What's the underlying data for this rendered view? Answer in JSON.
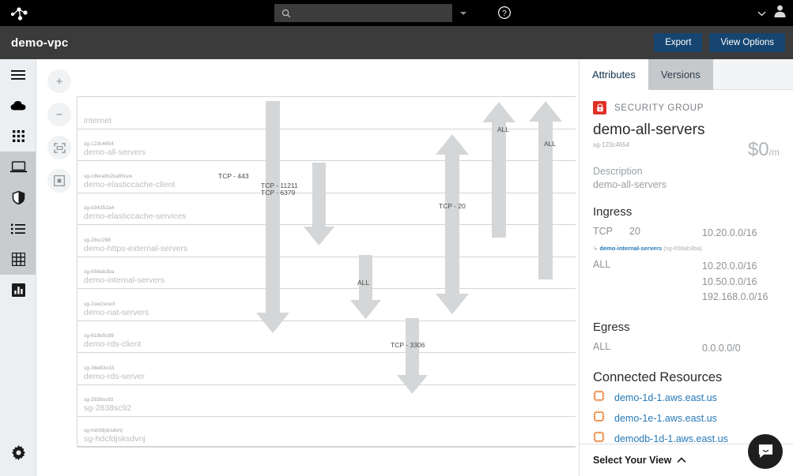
{
  "topbar": {
    "logo_icon": "network-nodes-logo",
    "search_placeholder": "",
    "search_value": "",
    "search_icon": "search-icon",
    "search_caret_icon": "caret-down-icon",
    "help_icon": "help-circle-icon",
    "account_caret_icon": "chevron-down-icon",
    "account_icon": "user-avatar-icon"
  },
  "subbar": {
    "title": "demo-vpc",
    "export_label": "Export",
    "view_options_label": "View Options"
  },
  "rail": {
    "items": [
      {
        "name": "menu-icon",
        "glyph": "hamburger"
      },
      {
        "name": "cloud-icon",
        "glyph": "cloud"
      },
      {
        "name": "apps-grid-icon",
        "glyph": "dots-grid"
      },
      {
        "name": "laptop-icon",
        "glyph": "laptop"
      },
      {
        "name": "shield-icon",
        "glyph": "shield"
      },
      {
        "name": "list-icon",
        "glyph": "list"
      },
      {
        "name": "table-icon",
        "glyph": "table"
      },
      {
        "name": "chart-icon",
        "glyph": "chart"
      }
    ],
    "settings_icon": "gear-icon"
  },
  "canvas": {
    "zoom_in_label": "+",
    "zoom_out_label": "−",
    "fit_icon": "fit-to-screen-icon",
    "center_icon": "center-target-icon",
    "rows": [
      {
        "id": "",
        "name": "internet",
        "is_internet": true
      },
      {
        "id": "sg-123c4654",
        "name": "demo-all-servers"
      },
      {
        "id": "sg-c8wıa9s2ka9fiıuw",
        "name": "demo-elasticcache-client"
      },
      {
        "id": "sg-d34352a4",
        "name": "demo-elasticcache-services"
      },
      {
        "id": "sg-28sc298",
        "name": "demo-https-external-servers"
      },
      {
        "id": "sg-658ab3ba",
        "name": "demo-internal-servers"
      },
      {
        "id": "sg-1sw2scw3",
        "name": "demo-nat-servers"
      },
      {
        "id": "sg-618e5c99",
        "name": "demo-rds-client"
      },
      {
        "id": "sg-38e83o33",
        "name": "demo-rds-server"
      },
      {
        "id": "sg-2838sc92",
        "name": "sg-2838sc92"
      },
      {
        "id": "sg-hdcfdjsksdvnj",
        "name": "sg-hdcfdjsksdvnj"
      }
    ],
    "connections": [
      {
        "label": "TCP - 443",
        "direction": "down"
      },
      {
        "label": "TCP - 11211\nTCP - 6379",
        "direction": "down"
      },
      {
        "label": "ALL",
        "direction": "down"
      },
      {
        "label": "TCP - 3306",
        "direction": "down"
      },
      {
        "label": "TCP - 20",
        "direction": "both"
      },
      {
        "label": "ALL",
        "direction": "up"
      },
      {
        "label": "ALL",
        "direction": "up"
      }
    ]
  },
  "panel": {
    "tabs": [
      {
        "label": "Attributes",
        "active": true
      },
      {
        "label": "Versions",
        "active": false
      }
    ],
    "badge_label": "SECURITY GROUP",
    "lock_icon": "lock-icon",
    "resource_name": "demo-all-servers",
    "resource_id": "sg-123c4654",
    "price": "$0",
    "price_unit": "/m",
    "description_label": "Description",
    "description_value": "demo-all-servers",
    "ingress_heading": "Ingress",
    "ingress_rules": [
      {
        "protocol": "TCP",
        "port": "20",
        "cidrs": [
          "10.20.0.0/16"
        ],
        "source_link": "demo-internal-servers",
        "source_id": "(sg-658ab3ba)"
      },
      {
        "protocol": "ALL",
        "port": "",
        "cidrs": [
          "10.20.0.0/16",
          "10.50.0.0/16",
          "192.168.0.0/16"
        ],
        "source_link": "",
        "source_id": ""
      }
    ],
    "egress_heading": "Egress",
    "egress_rules": [
      {
        "protocol": "ALL",
        "port": "",
        "cidrs": [
          "0.0.0.0/0"
        ]
      }
    ],
    "connected_heading": "Connected Resources",
    "connected_resources": [
      {
        "label": "demo-1d-1.aws.east.us",
        "icon": "instance-icon"
      },
      {
        "label": "demo-1e-1.aws.east.us",
        "icon": "instance-icon"
      },
      {
        "label": "demodb-1d-1.aws.east.us",
        "icon": "instance-icon"
      }
    ],
    "footer_label": "Select Your View",
    "footer_caret_icon": "chevron-up-icon",
    "chat_icon": "chat-bubble-icon"
  },
  "colors": {
    "topbar": "#000000",
    "subbar": "#3b3b3b",
    "button": "#154570",
    "rail": "#eceff1",
    "rail_active": "#c9cccf",
    "link": "#2779b8",
    "lock_red": "#e03127",
    "instance_orange": "#e8833a",
    "arrow_gray": "#d4d6d8"
  }
}
